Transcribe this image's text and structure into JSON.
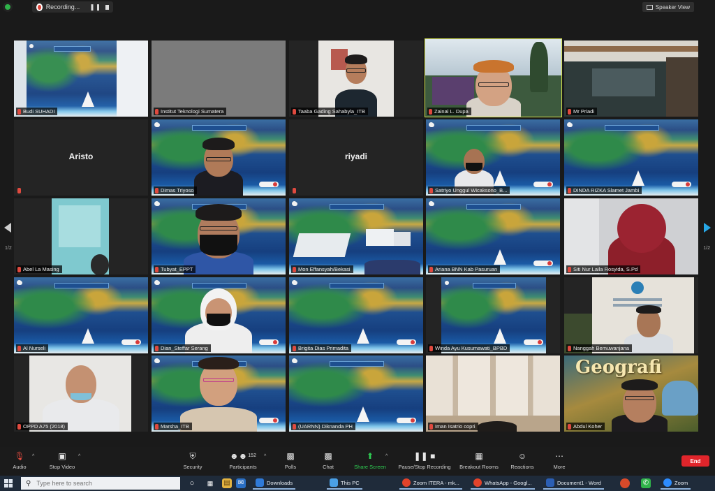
{
  "topbar": {
    "recording_label": "Recording...",
    "speaker_view_label": "Speaker View"
  },
  "tiles": [
    {
      "name": "Budi SUHADI"
    },
    {
      "name": "Institut Teknologi Sumatera"
    },
    {
      "name": "Taaba Gading Sahabyla_ITB"
    },
    {
      "name": "Zainal L. Dupa"
    },
    {
      "name": "Mr Priadi"
    },
    {
      "name": "Aristo",
      "center_label": "Aristo"
    },
    {
      "name": "Dimas Triyoso"
    },
    {
      "name": "riyadi",
      "center_label": "riyadi"
    },
    {
      "name": "Satriyo Unggul Wicaksono_B..."
    },
    {
      "name": "DINDA RIZKA Slamet Jambi"
    },
    {
      "name": "Abel La Masing"
    },
    {
      "name": "Tubyat_EPPT"
    },
    {
      "name": "Mon Effansyah/Bekasi"
    },
    {
      "name": "Ariana BNN Kab Pasuruan"
    },
    {
      "name": "Siti Nur Laila Rosyida, S.Pd"
    },
    {
      "name": "Al Nurseli"
    },
    {
      "name": "Dian_Steffar Serang"
    },
    {
      "name": "Brigita Dias Primadita"
    },
    {
      "name": "Winda Ayu Kusumawati_BPBD"
    },
    {
      "name": "Nanggah Bemuwanjana"
    },
    {
      "name": "OPPD A75 (2018)"
    },
    {
      "name": "Marsha_ITB"
    },
    {
      "name": "(UARNN) Diknanda PH"
    },
    {
      "name": "Iman Isatrio copri"
    },
    {
      "name": "Abdul Koher",
      "overlay_title": "Geografi"
    }
  ],
  "pagination": {
    "left": "1/2",
    "right": "1/2"
  },
  "controls": {
    "audio": "Audio",
    "stop_video": "Stop Video",
    "security": "Security",
    "participants": "Participants",
    "participants_count": "152",
    "polls": "Polls",
    "chat": "Chat",
    "share_screen": "Share Screen",
    "pause_recording": "Pause/Stop Recording",
    "breakout_rooms": "Breakout Rooms",
    "reactions": "Reactions",
    "more": "More",
    "end": "End"
  },
  "taskbar": {
    "search_placeholder": "Type here to search",
    "downloads": "Downloads",
    "this_pc": "This PC",
    "zoom_itera": "Zoom ITERA - mk...",
    "whatsapp": "WhatsApp - Googl...",
    "document": "Document1 - Word",
    "zoom": "Zoom"
  },
  "colors": {
    "active_speaker_border": "#d6e34d",
    "share_screen_green": "#2ecc52",
    "end_red": "#e0252b",
    "muted_red": "#e04a3f",
    "next_page_arrow": "#27a7e6"
  }
}
